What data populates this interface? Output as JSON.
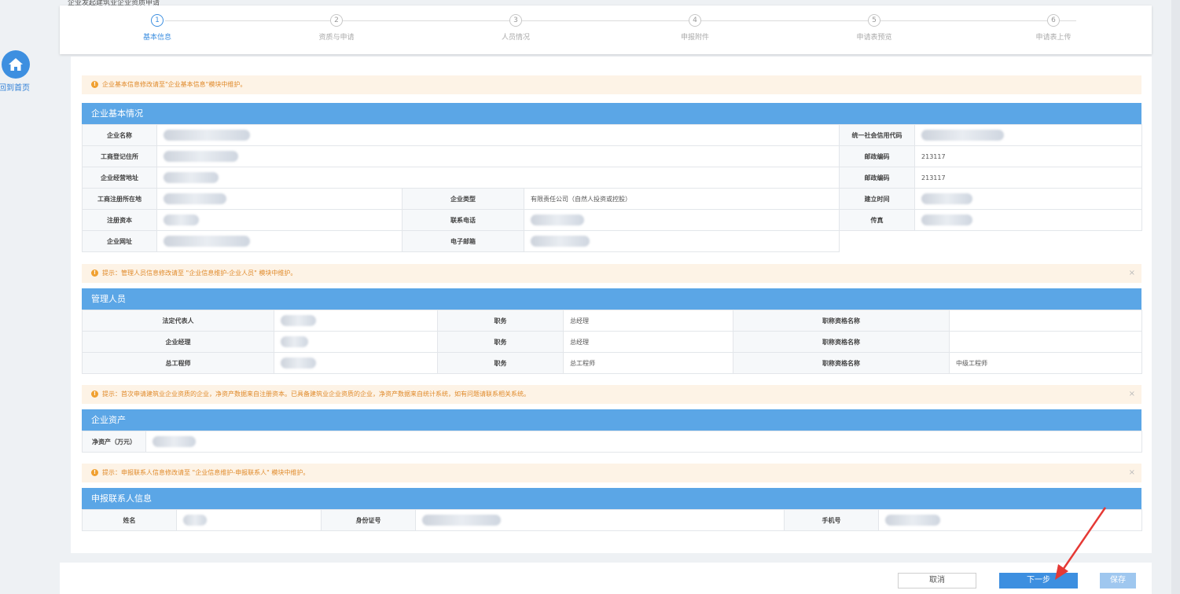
{
  "page_title": "企业发起建筑业企业资质申请",
  "home": {
    "label": "回到首页",
    "icon": "home-icon"
  },
  "steps": [
    {
      "num": "1",
      "label": "基本信息",
      "active": true
    },
    {
      "num": "2",
      "label": "资质与申请",
      "active": false
    },
    {
      "num": "3",
      "label": "人员情况",
      "active": false
    },
    {
      "num": "4",
      "label": "申报附件",
      "active": false
    },
    {
      "num": "5",
      "label": "申请表预览",
      "active": false
    },
    {
      "num": "6",
      "label": "申请表上传",
      "active": false
    }
  ],
  "notices": {
    "basic": "企业基本信息修改请至\"企业基本信息\"模块中维护。",
    "managers": "提示：管理人员信息修改请至 \"企业信息维护-企业人员\" 模块中维护。",
    "assets": "提示：首次申请建筑业企业资质的企业，净资产数据来自注册资本。已具备建筑业企业资质的企业，净资产数据来自统计系统，如有问题请联系相关系统。",
    "contact": "提示：申报联系人信息修改请至 \"企业信息维护-申报联系人\" 模块中维护。"
  },
  "sections": {
    "basic": "企业基本情况",
    "managers": "管理人员",
    "assets": "企业资产",
    "contact": "申报联系人信息"
  },
  "basic_info": {
    "company_name_label": "企业名称",
    "credit_code_label": "统一社会信用代码",
    "reg_address_label": "工商登记住所",
    "postcode_label_1": "邮政编码",
    "postcode_1": "213117",
    "office_address_label": "企业经营地址",
    "postcode_label_2": "邮政编码",
    "postcode_2": "213117",
    "reg_location_label": "工商注册所在地",
    "company_type_label": "企业类型",
    "company_type": "有限责任公司（自然人投资或控股）",
    "founded_label": "建立时间",
    "capital_label": "注册资本",
    "phone_label": "联系电话",
    "fax_label": "传真",
    "website_label": "企业网址",
    "email_label": "电子邮箱"
  },
  "managers": {
    "rows": [
      {
        "role_label": "法定代表人",
        "position_label": "职务",
        "position": "总经理",
        "title_label": "职称资格名称",
        "title": ""
      },
      {
        "role_label": "企业经理",
        "position_label": "职务",
        "position": "总经理",
        "title_label": "职称资格名称",
        "title": ""
      },
      {
        "role_label": "总工程师",
        "position_label": "职务",
        "position": "总工程师",
        "title_label": "职称资格名称",
        "title": "中级工程师"
      }
    ]
  },
  "assets": {
    "net_assets_label": "净资产（万元）"
  },
  "contact": {
    "name_label": "姓名",
    "id_label": "身份证号",
    "mobile_label": "手机号"
  },
  "footer": {
    "cancel": "取消",
    "next": "下一步",
    "save": "保存"
  },
  "colors": {
    "accent": "#3d8fe0",
    "section_header": "#5ba6e6",
    "notice_bg": "#fdf3e6",
    "notice_text": "#e08a2a",
    "arrow": "#e53935"
  }
}
